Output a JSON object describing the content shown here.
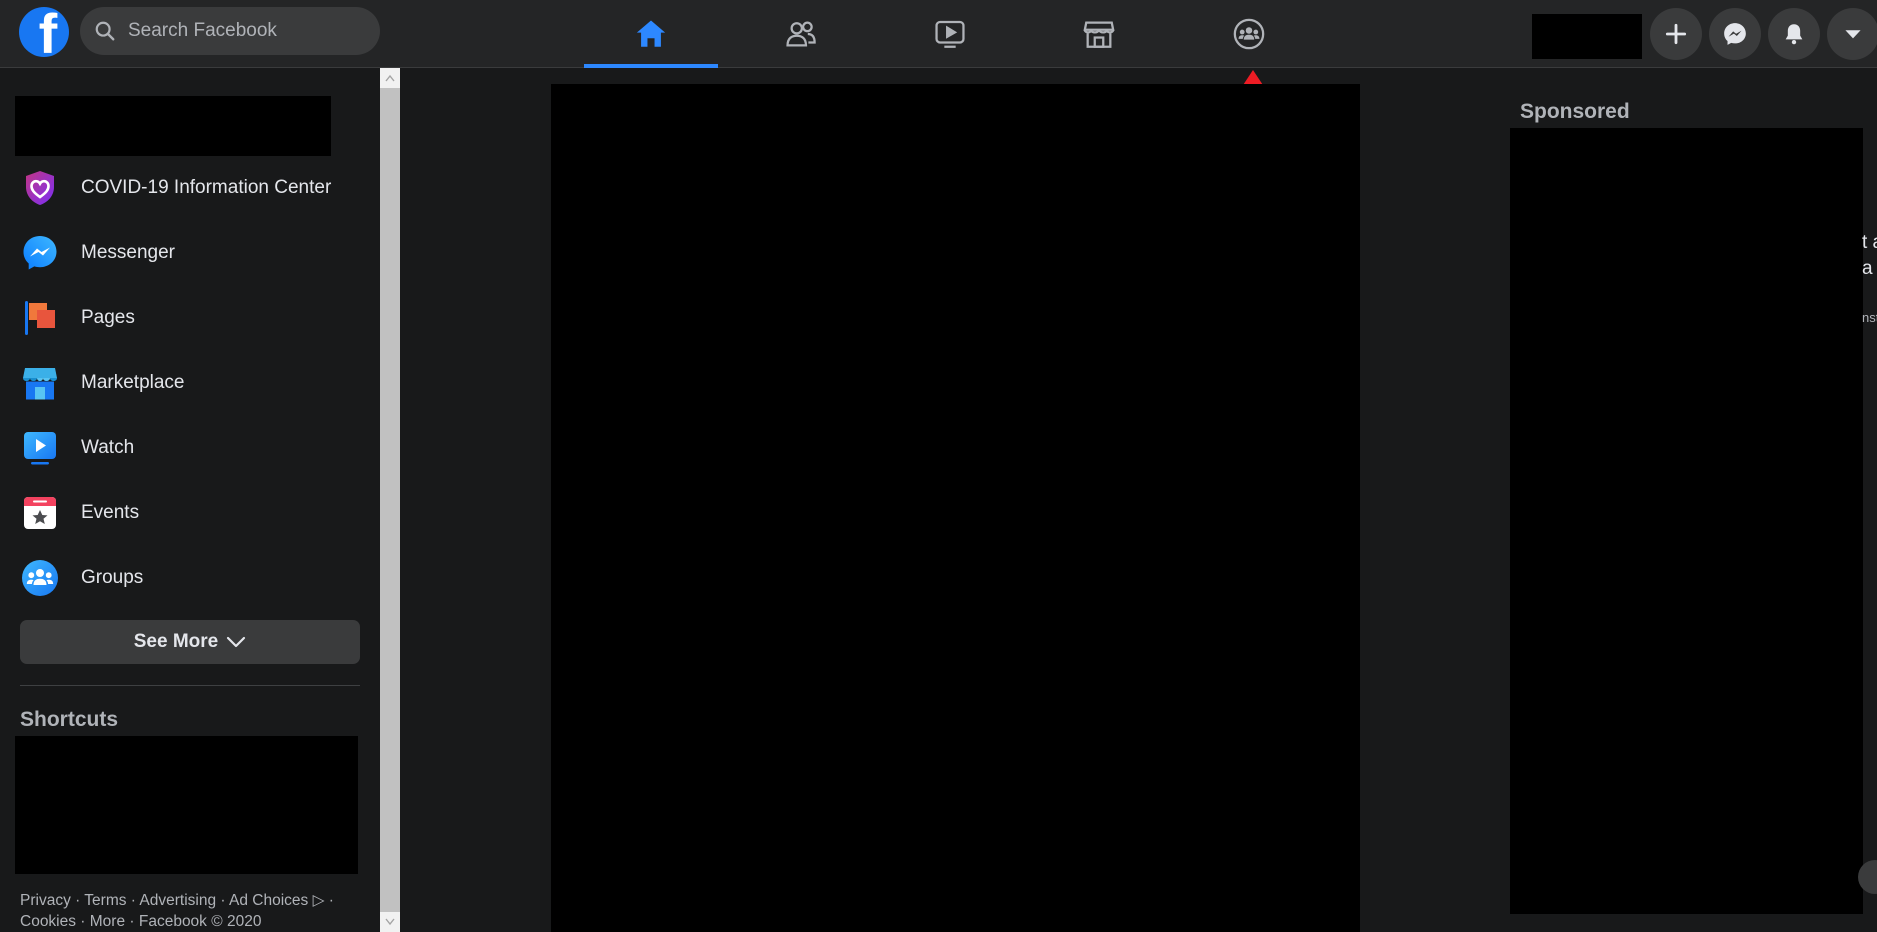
{
  "header": {
    "logo_letter": "f",
    "search": {
      "placeholder": "Search Facebook",
      "value": ""
    },
    "nav_tabs": [
      {
        "name": "home",
        "icon": "home-icon",
        "active": true
      },
      {
        "name": "friends",
        "icon": "friends-icon",
        "active": false
      },
      {
        "name": "watch",
        "icon": "watch-icon",
        "active": false
      },
      {
        "name": "marketplace",
        "icon": "marketplace-icon",
        "active": false
      },
      {
        "name": "groups",
        "icon": "groups-icon",
        "active": false
      }
    ],
    "right_buttons": [
      "plus-icon",
      "messenger-icon",
      "bell-icon",
      "caret-down-icon"
    ],
    "accent_color": "#2d88ff"
  },
  "annotation": {
    "arrow_color": "#ed1c24",
    "points_to": "groups-tab"
  },
  "sidebar": {
    "items": [
      {
        "label": "COVID-19 Information Center",
        "icon": "covid-heart-shield-icon"
      },
      {
        "label": "Messenger",
        "icon": "messenger-icon"
      },
      {
        "label": "Pages",
        "icon": "pages-flag-icon"
      },
      {
        "label": "Marketplace",
        "icon": "marketplace-store-icon"
      },
      {
        "label": "Watch",
        "icon": "watch-play-icon"
      },
      {
        "label": "Events",
        "icon": "events-calendar-icon"
      },
      {
        "label": "Groups",
        "icon": "groups-people-icon"
      }
    ],
    "see_more_label": "See More",
    "shortcuts_title": "Shortcuts",
    "footer": "Privacy · Terms · Advertising · Ad Choices ▷ · Cookies · More · Facebook © 2020"
  },
  "right_column": {
    "sponsored_title": "Sponsored",
    "edge_fragments": [
      "t a",
      "a",
      "nst"
    ]
  }
}
